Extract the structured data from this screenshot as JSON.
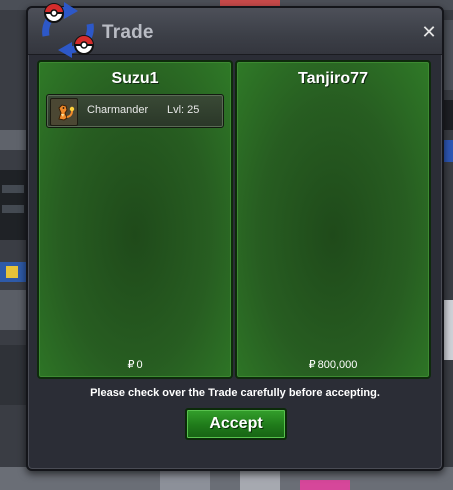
{
  "window": {
    "title": "Trade",
    "close_icon": "close-icon",
    "trade_icon": "pokeball-swap-icon"
  },
  "left_panel": {
    "player_name": "Suzu1",
    "items": [
      {
        "icon": "charmander-icon",
        "name": "Charmander",
        "level": "Lvl: 25"
      }
    ],
    "currency_symbol": "₽",
    "money": "0"
  },
  "right_panel": {
    "player_name": "Tanjiro77",
    "items": [],
    "currency_symbol": "₽",
    "money": "800,000"
  },
  "notice": "Please check over the Trade carefully before accepting.",
  "accept_label": "Accept",
  "colors": {
    "panel_green": "#2f7a27",
    "accept_green": "#1f7a1a",
    "window_bg": "#2b2d36"
  }
}
